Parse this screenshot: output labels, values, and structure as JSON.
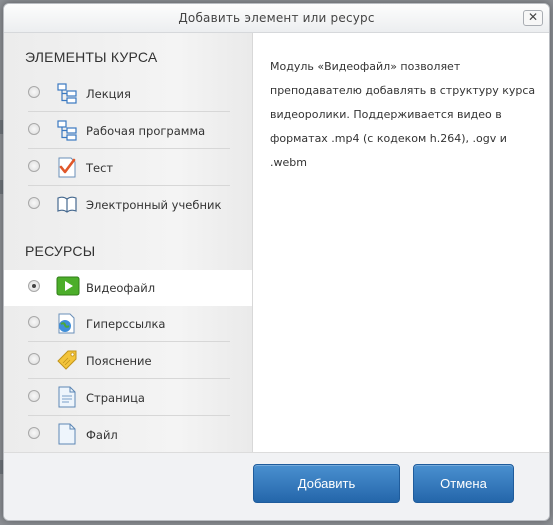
{
  "dialog": {
    "title": "Добавить элемент или ресурс",
    "close_glyph": "✕"
  },
  "sections": {
    "course_elements": "ЭЛЕМЕНТЫ КУРСА",
    "resources": "РЕСУРСЫ"
  },
  "course_elements": [
    {
      "label": "Лекция",
      "icon": "lesson-icon",
      "selected": false
    },
    {
      "label": "Рабочая программа",
      "icon": "workshop-icon",
      "selected": false
    },
    {
      "label": "Тест",
      "icon": "quiz-icon",
      "selected": false
    },
    {
      "label": "Электронный учебник",
      "icon": "book-icon",
      "selected": false
    }
  ],
  "resources": [
    {
      "label": "Видеофайл",
      "icon": "video-file-icon",
      "selected": true
    },
    {
      "label": "Гиперссылка",
      "icon": "url-icon",
      "selected": false
    },
    {
      "label": "Пояснение",
      "icon": "label-icon",
      "selected": false
    },
    {
      "label": "Страница",
      "icon": "page-icon",
      "selected": false
    },
    {
      "label": "Файл",
      "icon": "file-icon",
      "selected": false
    }
  ],
  "description": "Модуль «Видеофайл» позволяет преподавателю добавлять в структуру курса видеоролики. Поддерживается видео в форматах .mp4 (с кодеком h.264), .ogv и .webm",
  "buttons": {
    "add": "Добавить",
    "cancel": "Отмена"
  },
  "colors": {
    "primary_button": "#2f78c0",
    "selected_row": "#ffffff",
    "panel_bg": "#efefef"
  }
}
